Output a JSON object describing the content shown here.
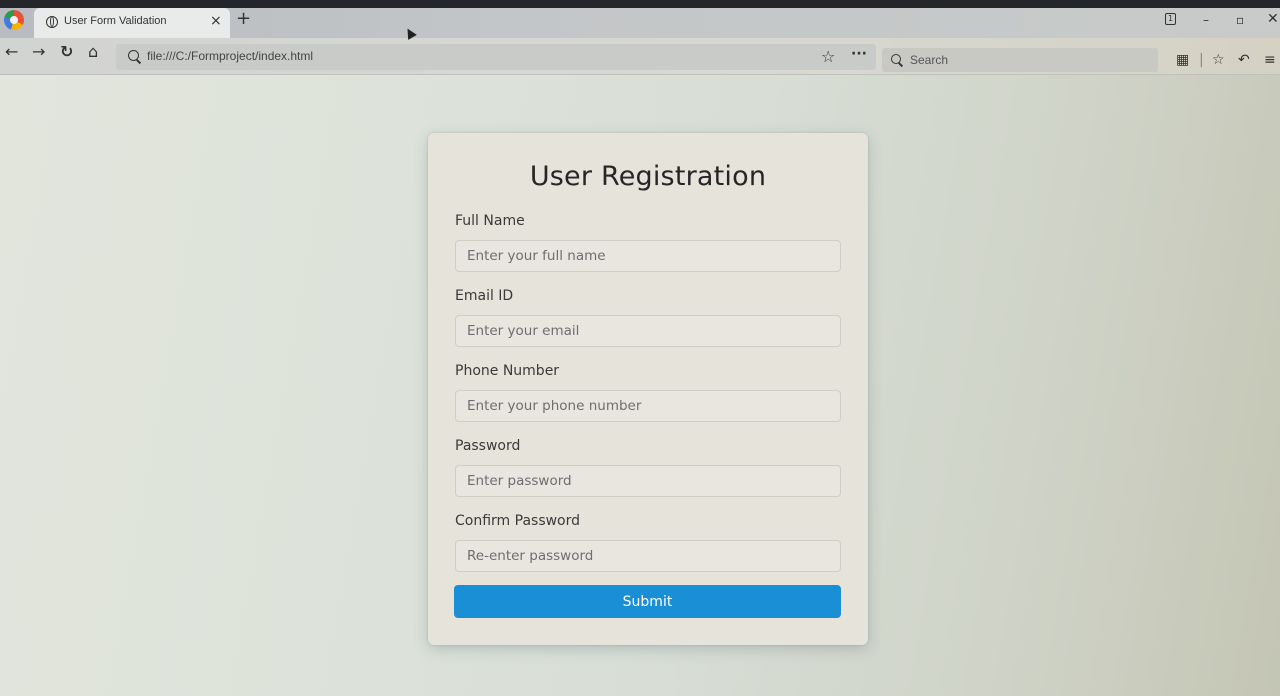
{
  "browser": {
    "tab_title": "User Form Validation",
    "url": "file:///C:/Formproject/index.html",
    "search_placeholder": "Search"
  },
  "form": {
    "title": "User Registration",
    "fields": [
      {
        "label": "Full Name",
        "placeholder": "Enter your full name"
      },
      {
        "label": "Email ID",
        "placeholder": "Enter your email"
      },
      {
        "label": "Phone Number",
        "placeholder": "Enter your phone number"
      },
      {
        "label": "Password",
        "placeholder": "Enter password"
      },
      {
        "label": "Confirm Password",
        "placeholder": "Re-enter password"
      }
    ],
    "submit_label": "Submit"
  },
  "colors": {
    "submit_button": "#1a8fd6",
    "card_background": "#e5e3da"
  },
  "icons": [
    "browser-logo-icon",
    "globe-icon",
    "close-icon",
    "new-tab-icon",
    "back-icon",
    "forward-icon",
    "reload-icon",
    "home-icon",
    "search-icon",
    "bookmark-star-icon",
    "page-actions-icon",
    "extensions-icon",
    "bookmarks-list-icon",
    "undo-icon",
    "menu-icon",
    "window-minimize-icon",
    "window-restore-icon",
    "window-close-icon"
  ]
}
